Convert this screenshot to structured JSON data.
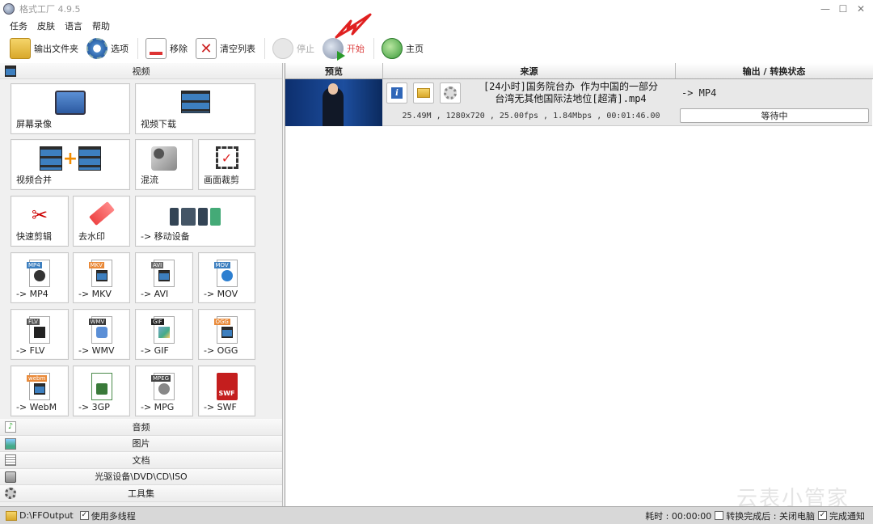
{
  "window": {
    "title": "格式工厂 4.9.5",
    "min_glyph": "—",
    "max_glyph": "☐",
    "close_glyph": "✕"
  },
  "menu": [
    "任务",
    "皮肤",
    "语言",
    "帮助"
  ],
  "toolbar": {
    "output_folder": "输出文件夹",
    "options": "选项",
    "remove": "移除",
    "clear_list": "清空列表",
    "stop": "停止",
    "start": "开始",
    "home": "主页"
  },
  "left_panel": {
    "video_header": "视频",
    "tiles": {
      "screen_record": "屏幕录像",
      "video_download": "视频下载",
      "video_merge": "视频合并",
      "mix": "混流",
      "crop": "画面裁剪",
      "quick_clip": "快速剪辑",
      "remove_watermark": "去水印",
      "mobile": "-> 移动设备",
      "mp4": "-> MP4",
      "mkv": "-> MKV",
      "avi": "-> AVI",
      "mov": "-> MOV",
      "flv": "-> FLV",
      "wmv": "-> WMV",
      "gif": "-> GIF",
      "ogg": "-> OGG",
      "webm": "-> WebM",
      "3gp": "-> 3GP",
      "mpg": "-> MPG",
      "swf": "-> SWF"
    },
    "icon_tags": {
      "mp4": "MP4",
      "mkv": "MKV",
      "avi": "AVI",
      "mov": "MOV",
      "flv": "FLV",
      "wmv": "WMV",
      "gif": "GIF",
      "ogg": "OGG",
      "webm": "webm",
      "mpg": "MPEG",
      "swf": "SWF"
    },
    "categories": [
      "音频",
      "图片",
      "文档",
      "光驱设备\\DVD\\CD\\ISO",
      "工具集"
    ]
  },
  "task_table": {
    "columns": [
      "预览",
      "来源",
      "输出 / 转换状态"
    ],
    "rows": [
      {
        "source_name_line1": "[24小时]国务院台办 作为中国的一部分",
        "source_name_line2": "台湾无其他国际法地位[超清].mp4",
        "meta": "25.49M , 1280x720 , 25.00fps , 1.84Mbps , 00:01:46.00",
        "output_format": "-> MP4",
        "status": "等待中",
        "info_glyph": "i"
      }
    ]
  },
  "watermark": "云表小管家",
  "statusbar": {
    "output_path": "D:\\FFOutput",
    "multithread_label": "使用多线程",
    "multithread_checked": true,
    "elapsed": "耗时 : 00:00:00",
    "after_convert": "转换完成后 : 关闭电脑",
    "after_convert_checked": false,
    "notify_label": "完成通知",
    "notify_checked": true,
    "check_glyph": "✓"
  },
  "colors": {
    "start_label": "#dd4444",
    "annotation_arrow": "#e02020"
  }
}
